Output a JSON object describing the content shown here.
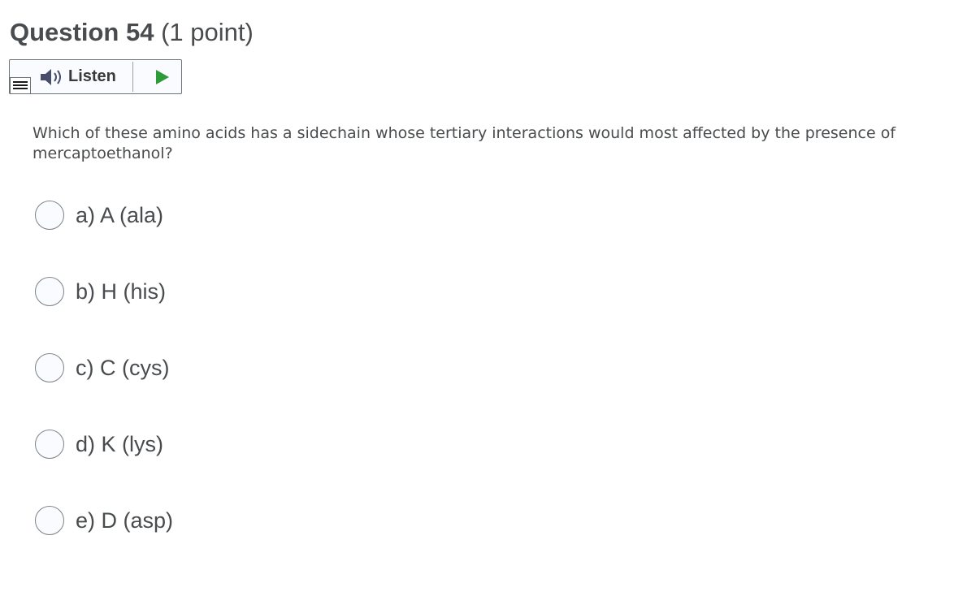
{
  "question": {
    "label": "Question 54",
    "points": "(1 point)",
    "prompt": "Which of these amino acids has a sidechain whose tertiary interactions would most affected by the presence of mercaptoethanol?"
  },
  "listen": {
    "label": "Listen",
    "icons": {
      "menu": "menu-icon",
      "speaker": "speaker-icon",
      "play": "play-icon"
    },
    "colors": {
      "play": "#2e9b3a",
      "speaker": "#474d6b"
    }
  },
  "options": [
    {
      "label": "a)  A (ala)",
      "selected": false
    },
    {
      "label": "b)  H (his)",
      "selected": false
    },
    {
      "label": "c)  C (cys)",
      "selected": false
    },
    {
      "label": "d)  K (lys)",
      "selected": false
    },
    {
      "label": "e)  D (asp)",
      "selected": false
    }
  ]
}
